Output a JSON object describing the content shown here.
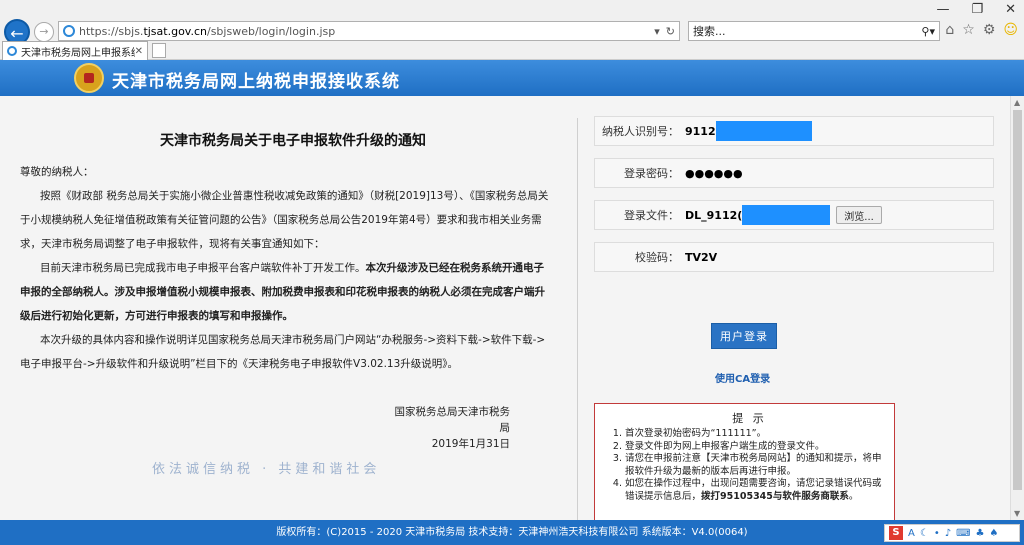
{
  "browser": {
    "url_prefix": "https://sbjs.",
    "url_domain": "tjsat.gov.cn",
    "url_suffix": "/sbjsweb/login/login.jsp",
    "search_placeholder": "搜索...",
    "tab_title": "天津市税务局网上申报系统"
  },
  "header": {
    "title": "天津市税务局网上纳税申报接收系统"
  },
  "notice": {
    "title": "天津市税务局关于电子申报软件升级的通知",
    "greeting": "尊敬的纳税人：",
    "para1": "按照《财政部 税务总局关于实施小微企业普惠性税收减免政策的通知》（财税[2019]13号）、《国家税务总局关于小规模纳税人免征增值税政策有关征管问题的公告》（国家税务总局公告2019年第4号）要求和我市相关业务需求，天津市税务局调整了电子申报软件，现将有关事宜通知如下：",
    "para2_plain": "目前天津市税务局已完成我市电子申报平台客户端软件补丁开发工作。",
    "para2_bold": "本次升级涉及已经在税务系统开通电子申报的全部纳税人。涉及申报增值税小规模申报表、附加税费申报表和印花税申报表的纳税人必须在完成客户端升级后进行初始化更新，方可进行申报表的填写和申报操作。",
    "para3": "本次升级的具体内容和操作说明详见国家税务总局天津市税务局门户网站“办税服务->资料下载->软件下载->电子申报平台->升级软件和升级说明”栏目下的《天津税务电子申报软件V3.02.13升级说明》。",
    "sign_org": "国家税务总局天津市税务局",
    "sign_date": "2019年1月31日",
    "slogan": "依法诚信纳税 · 共建和谐社会"
  },
  "login": {
    "taxid_label": "纳税人识别号：",
    "taxid_value": "9112",
    "password_label": "登录密码：",
    "password_value": "●●●●●●",
    "file_label": "登录文件：",
    "file_value": "DL_9112(",
    "browse_label": "浏览...",
    "captcha_label": "校验码：",
    "captcha_value": "TV2V",
    "login_button": "用户登录",
    "ca_link": "使用CA登录",
    "mask_color": "#1e90ff"
  },
  "tips": {
    "title": "提 示",
    "items": [
      "首次登录初始密码为“111111”。",
      "登录文件即为网上申报客户端生成的登录文件。",
      "请您在申报前注意【天津市税务局网站】的通知和提示，将申报软件升级为最新的版本后再进行申报。",
      "如您在操作过程中，出现问题需要咨询，请您记录错误代码或错误提示信息后，"
    ],
    "item4_bold": "拨打95105345与软件服务商联系",
    "item4_end": "。"
  },
  "footer": {
    "text": "版权所有：(C)2015 - 2020 天津市税务局  技术支持：天津神州浩天科技有限公司 系统版本：V4.0(0064)"
  },
  "colors": {
    "header_blue": "#1f6fc4",
    "tips_border": "#c23a3a"
  }
}
